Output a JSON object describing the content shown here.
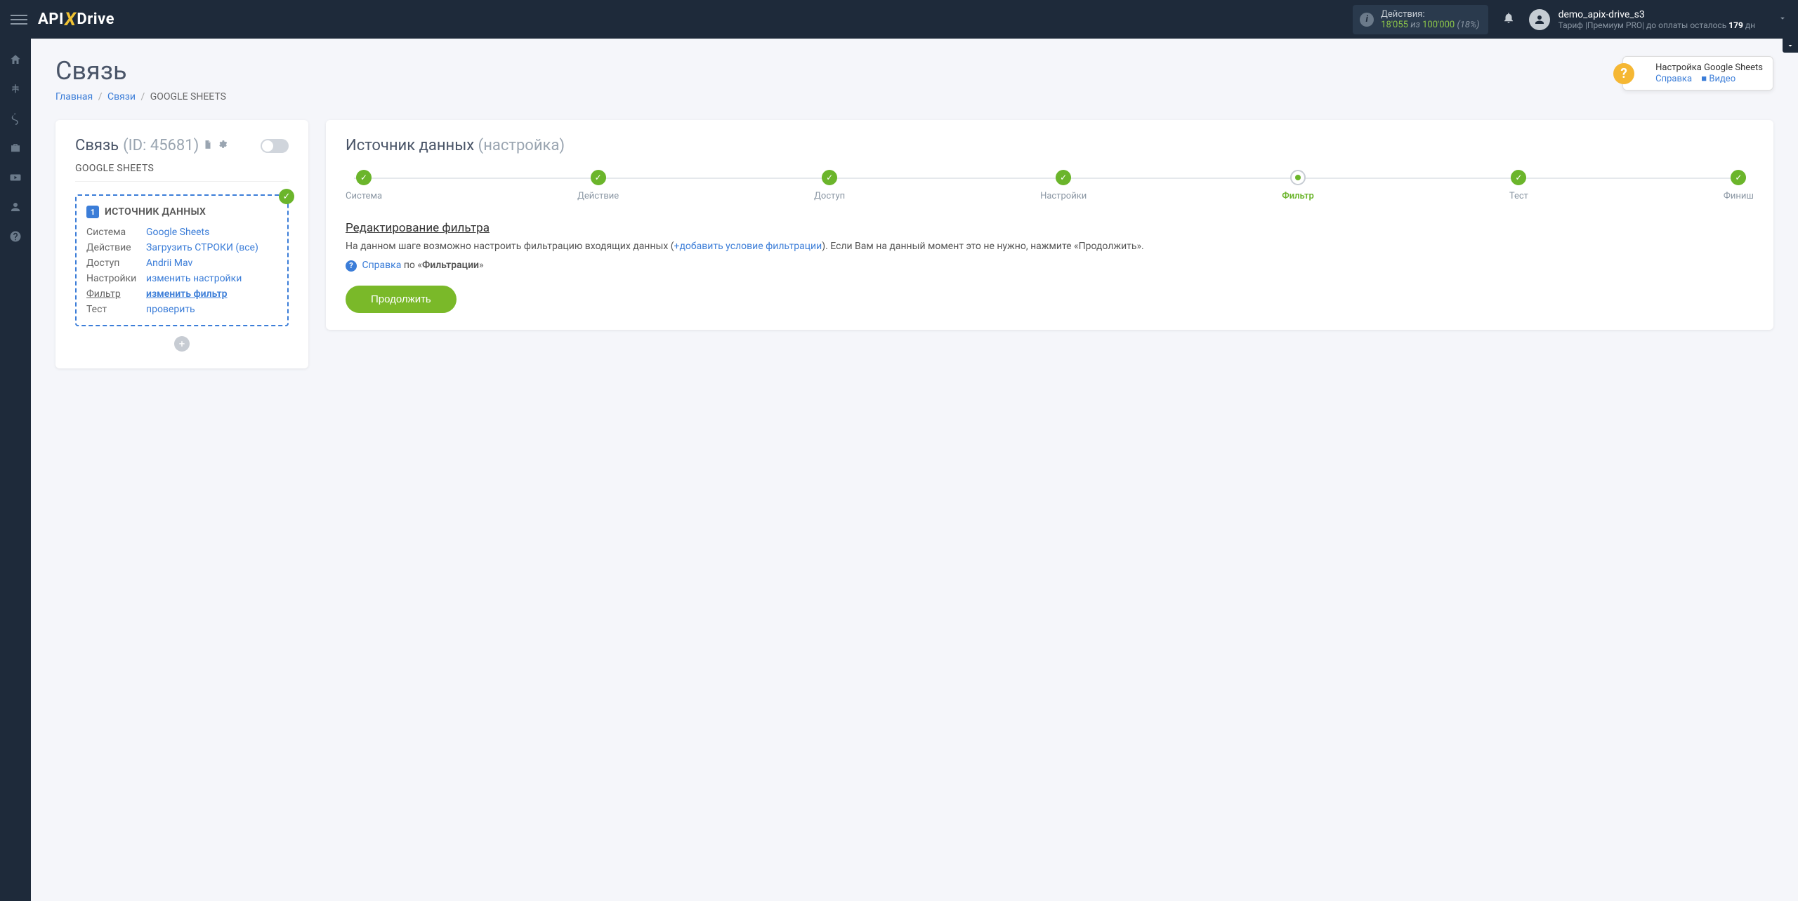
{
  "topbar": {
    "logo": {
      "p1": "API",
      "p2": "X",
      "p3": "Drive"
    },
    "actions": {
      "label": "Действия:",
      "used": "18'055",
      "of": "из",
      "total": "100'000",
      "pct": "(18%)"
    },
    "user": {
      "name": "demo_apix-drive_s3",
      "tariff_pre": "Тариф |Премиум PRO| до оплаты осталось ",
      "days": "179",
      "tariff_post": " дн"
    }
  },
  "page": {
    "title": "Связь",
    "breadcrumb": {
      "home": "Главная",
      "links": "Связи",
      "current": "GOOGLE SHEETS"
    }
  },
  "helpbox": {
    "title": "Настройка Google Sheets",
    "ref": "Справка",
    "video": "Видео"
  },
  "conn": {
    "label": "Связь",
    "id": "(ID: 45681)",
    "sub": "GOOGLE SHEETS"
  },
  "source": {
    "num": "1",
    "head": "ИСТОЧНИК ДАННЫХ",
    "rows": [
      {
        "k": "Система",
        "v": "Google Sheets",
        "active": false
      },
      {
        "k": "Действие",
        "v": "Загрузить СТРОКИ (все)",
        "active": false
      },
      {
        "k": "Доступ",
        "v": "Andrii Mav",
        "active": false
      },
      {
        "k": "Настройки",
        "v": "изменить настройки",
        "active": false
      },
      {
        "k": "Фильтр",
        "v": "изменить фильтр",
        "active": true
      },
      {
        "k": "Тест",
        "v": "проверить",
        "active": false
      }
    ]
  },
  "right": {
    "title": "Источник данных",
    "sub": "(настройка)"
  },
  "steps": [
    {
      "label": "Система",
      "state": "done"
    },
    {
      "label": "Действие",
      "state": "done"
    },
    {
      "label": "Доступ",
      "state": "done"
    },
    {
      "label": "Настройки",
      "state": "done"
    },
    {
      "label": "Фильтр",
      "state": "current"
    },
    {
      "label": "Тест",
      "state": "done"
    },
    {
      "label": "Финиш",
      "state": "done"
    }
  ],
  "filter": {
    "heading": "Редактирование фильтра",
    "desc_pre": "На данном шаге возможно настроить фильтрацию входящих данных (",
    "add_link": "добавить условие фильтрации",
    "desc_post": "). Если Вам на данный момент это не нужно, нажмите «Продолжить».",
    "help_ref": "Справка",
    "help_mid": " по «",
    "help_topic": "Фильтрации",
    "help_end": "»",
    "continue": "Продолжить"
  }
}
